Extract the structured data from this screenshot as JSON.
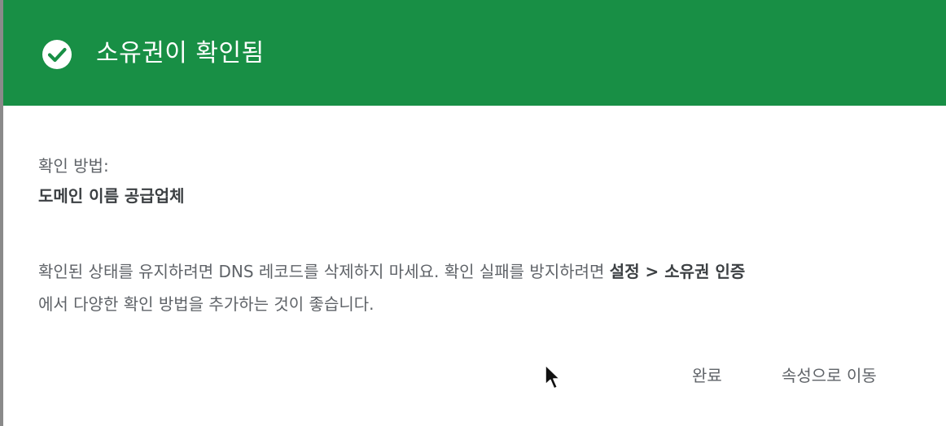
{
  "header": {
    "title": "소유권이 확인됨",
    "icon": "check-circle-icon",
    "background_color": "#188f45"
  },
  "method": {
    "label": "확인 방법:",
    "value": "도메인 이름 공급업체"
  },
  "description": {
    "line1_text": "확인된 상태를 유지하려면 DNS 레코드를 삭제하지 마세요. 확인 실패를 방지하려면 ",
    "line1_bold": "설정 > 소유권 인증",
    "line2_text": "에서 다양한 확인 방법을 추가하는 것이 좋습니다."
  },
  "actions": {
    "done_label": "완료",
    "go_to_property_label": "속성으로 이동"
  },
  "cursor": {
    "icon": "mouse-pointer-icon"
  }
}
